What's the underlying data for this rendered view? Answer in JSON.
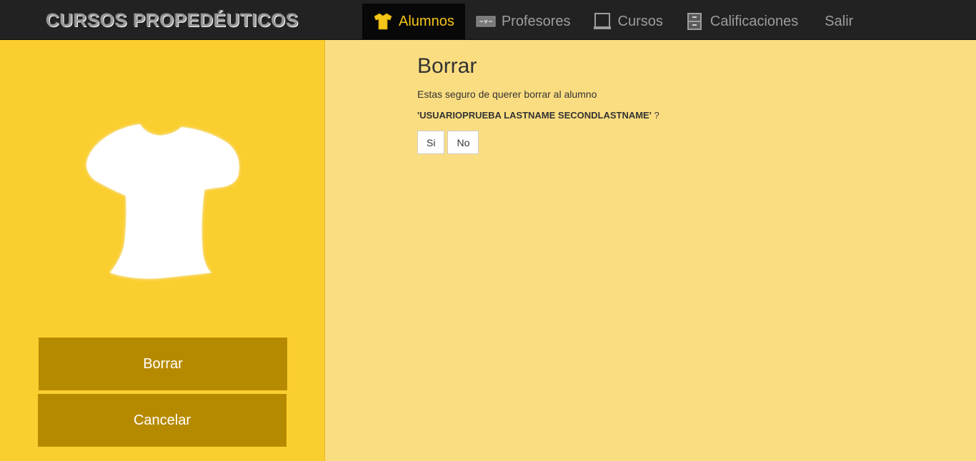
{
  "brand": "CURSOS PROPEDÉUTICOS",
  "nav": {
    "items": [
      {
        "label": "Alumnos",
        "icon": "shirt-icon",
        "active": true
      },
      {
        "label": "Profesores",
        "icon": "tie-icon",
        "active": false
      },
      {
        "label": "Cursos",
        "icon": "book-icon",
        "active": false
      },
      {
        "label": "Calificaciones",
        "icon": "cabinet-icon",
        "active": false
      },
      {
        "label": "Salir",
        "icon": "",
        "active": false
      }
    ],
    "active_color": "#f5c518"
  },
  "sidebar": {
    "image_icon": "shirt-icon",
    "borrar_label": "Borrar",
    "cancelar_label": "Cancelar"
  },
  "main": {
    "title": "Borrar",
    "message": "Estas seguro de querer borrar al alumno",
    "student_name": "'USUARIOPRUEBA LASTNAME SECONDLASTNAME'",
    "question_mark": " ?",
    "yes_label": "Si",
    "no_label": "No"
  },
  "colors": {
    "navbar": "#222222",
    "sidebar": "#fbce2f",
    "content": "#fbdd81",
    "button": "#b68a00"
  }
}
